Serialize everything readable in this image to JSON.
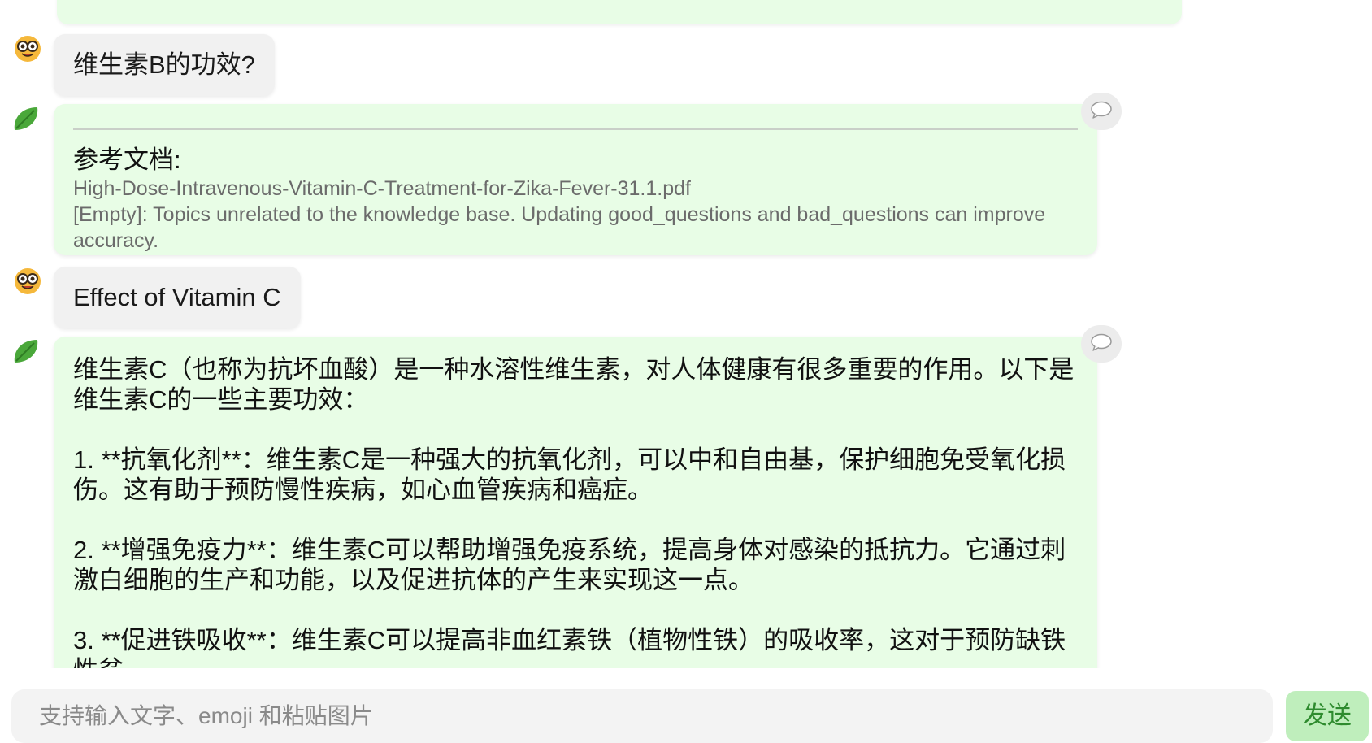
{
  "messages": [
    {
      "role": "user",
      "text": "维生素B的功效?"
    },
    {
      "role": "bot",
      "reference_title": "参考文档:",
      "reference_file": "High-Dose-Intravenous-Vitamin-C-Treatment-for-Zika-Fever-31.1.pdf",
      "reference_note": "[Empty]: Topics unrelated to the knowledge base. Updating good_questions and bad_questions can improve accuracy."
    },
    {
      "role": "user",
      "text": "Effect of Vitamin C"
    },
    {
      "role": "bot",
      "text": "维生素C（也称为抗坏血酸）是一种水溶性维生素，对人体健康有很多重要的作用。以下是维生素C的一些主要功效：\n\n1. **抗氧化剂**：维生素C是一种强大的抗氧化剂，可以中和自由基，保护细胞免受氧化损伤。这有助于预防慢性疾病，如心血管疾病和癌症。\n\n2. **增强免疫力**：维生素C可以帮助增强免疫系统，提高身体对感染的抵抗力。它通过刺激白细胞的生产和功能，以及促进抗体的产生来实现这一点。\n\n3. **促进铁吸收**：维生素C可以提高非血红素铁（植物性铁）的吸收率，这对于预防缺铁性贫"
    }
  ],
  "input": {
    "placeholder": "支持输入文字、emoji 和粘贴图片",
    "value": ""
  },
  "send_button": {
    "label": "发送"
  },
  "colors": {
    "bot_bubble": "#e8fde6",
    "user_bubble": "#f1f1f1",
    "send_button_bg": "#bfeebc",
    "send_button_text": "#2e8b2e"
  },
  "icons": {
    "user_avatar": "nerd-face-avatar-icon",
    "bot_avatar": "green-leaf-avatar-icon",
    "comment": "speech-bubble-icon"
  }
}
